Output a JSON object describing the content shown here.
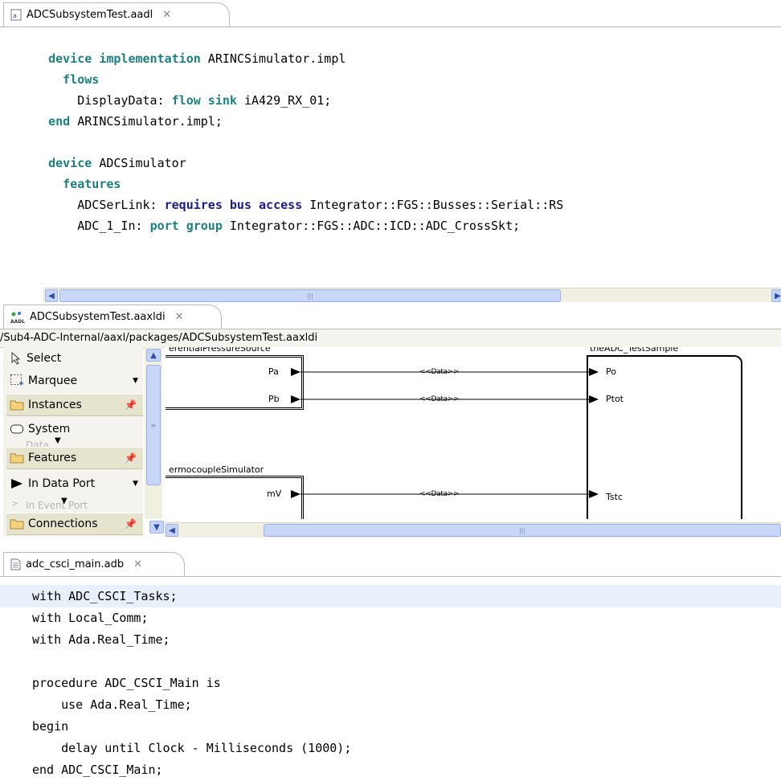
{
  "editor1": {
    "tab": "ADCSubsystemTest.aadl",
    "lines": [
      [
        {
          "t": "    device implementation",
          "c": "kw"
        },
        {
          "t": " ARINCSimulator.impl"
        }
      ],
      [
        {
          "t": "      flows",
          "c": "kw"
        }
      ],
      [
        {
          "t": "        DisplayData: "
        },
        {
          "t": "flow sink",
          "c": "kw"
        },
        {
          "t": " iA429_RX_01;"
        }
      ],
      [
        {
          "t": "    end",
          "c": "kw"
        },
        {
          "t": " ARINCSimulator.impl;"
        }
      ],
      [
        {
          "t": ""
        }
      ],
      [
        {
          "t": "    device",
          "c": "kw"
        },
        {
          "t": " ADCSimulator"
        }
      ],
      [
        {
          "t": "      features",
          "c": "kw"
        }
      ],
      [
        {
          "t": "        ADCSerLink: "
        },
        {
          "t": "requires bus access",
          "c": "kw2"
        },
        {
          "t": " Integrator::FGS::Busses::Serial::RS"
        }
      ],
      [
        {
          "t": "        ADC_1_In: "
        },
        {
          "t": "port group",
          "c": "kw"
        },
        {
          "t": " Integrator::FGS::ADC::ICD::ADC_CrossSkt;"
        }
      ]
    ]
  },
  "editor2": {
    "tab": "ADCSubsystemTest.aaxldi",
    "path": "/Sub4-ADC-Internal/aaxl/packages/ADCSubsystemTest.aaxldi",
    "palette": {
      "select": "Select",
      "marquee": "Marquee",
      "instances": "Instances",
      "system": "System",
      "data_partial": "Data",
      "features": "Features",
      "in_data_port": "In Data Port",
      "in_event_port": "In Event Port",
      "connections": "Connections"
    },
    "diagram": {
      "src1_title": "erentialPressureSource",
      "src1_port_a": "Pa",
      "src1_port_b": "Pb",
      "src2_title": "ermocoupleSimulator",
      "src2_port": "mV",
      "target_title": "theADC_TestSample",
      "target_port_1": "Po",
      "target_port_2": "Ptot",
      "target_port_3": "Tstc",
      "conn_label_1": "<<Data>>",
      "conn_label_2": "<<Data>>",
      "conn_label_3": "<<Data>>"
    }
  },
  "editor3": {
    "tab": "adc_csci_main.adb",
    "lines": [
      "with ADC_CSCI_Tasks;",
      "with Local_Comm;",
      "with Ada.Real_Time;",
      "",
      "procedure ADC_CSCI_Main is",
      "    use Ada.Real_Time;",
      "begin",
      "    delay until Clock - Milliseconds (1000);",
      "end ADC_CSCI_Main;"
    ]
  },
  "icons": [
    "aadl-file-icon",
    "close-icon",
    "aaxldi-file-icon",
    "adb-file-icon",
    "cursor-arrow-icon",
    "marquee-icon",
    "folder-icon",
    "pin-icon",
    "system-rect-icon",
    "in-data-port-icon",
    "in-event-port-icon",
    "chevron-down-icon",
    "arrow-left-icon",
    "arrow-right-icon",
    "arrow-up-icon",
    "arrow-down-icon"
  ],
  "colors": {
    "keyword": "#1e7f80",
    "keyword_emph": "#1b1b8f",
    "highlight_line": "#e8f0fb",
    "palette_drawer": "#e6e3cf"
  }
}
